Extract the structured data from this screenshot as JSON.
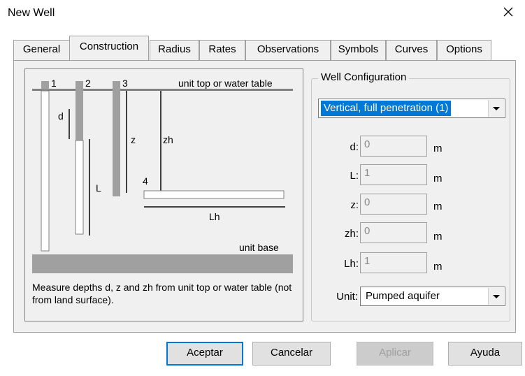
{
  "window": {
    "title": "New Well"
  },
  "tabs": [
    {
      "label": "General"
    },
    {
      "label": "Construction"
    },
    {
      "label": "Radius"
    },
    {
      "label": "Rates"
    },
    {
      "label": "Observations"
    },
    {
      "label": "Symbols"
    },
    {
      "label": "Curves"
    },
    {
      "label": "Options"
    }
  ],
  "active_tab": "Construction",
  "diagram": {
    "well_numbers": [
      "1",
      "2",
      "3",
      "4"
    ],
    "top_label": "unit top or water table",
    "base_label": "unit base",
    "labels": {
      "d": "d",
      "L": "L",
      "z": "z",
      "zh": "zh",
      "Lh": "Lh"
    },
    "note": "Measure depths d, z and zh from unit top or water table (not from land surface)."
  },
  "config": {
    "group_title": "Well Configuration",
    "selected": "Vertical, full penetration (1)",
    "fields": [
      {
        "label": "d:",
        "value": "0",
        "unit": "m"
      },
      {
        "label": "L:",
        "value": "1",
        "unit": "m"
      },
      {
        "label": "z:",
        "value": "0",
        "unit": "m"
      },
      {
        "label": "zh:",
        "value": "0",
        "unit": "m"
      },
      {
        "label": "Lh:",
        "value": "1",
        "unit": "m"
      }
    ],
    "unit_label": "Unit:",
    "unit_value": "Pumped aquifer"
  },
  "buttons": {
    "ok": "Aceptar",
    "cancel": "Cancelar",
    "apply": "Aplicar",
    "help": "Ayuda"
  },
  "colors": {
    "accent": "#0078d7",
    "well_gray": "#a0a0a0"
  }
}
